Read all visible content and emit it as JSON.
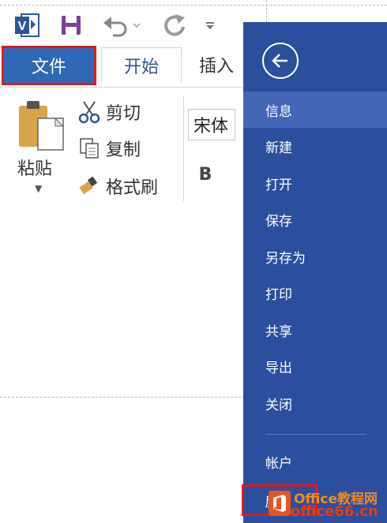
{
  "quick_access": {
    "app_icon": "visio-app-icon",
    "save_icon": "save-icon",
    "undo_icon": "undo-icon",
    "redo_icon": "redo-icon",
    "more_icon": "customize-dropdown-icon"
  },
  "tabs": {
    "file": "文件",
    "home": "开始",
    "insert": "插入"
  },
  "clipboard": {
    "paste": "粘贴",
    "cut": "剪切",
    "copy": "复制",
    "format_painter": "格式刷"
  },
  "font": {
    "name": "宋体",
    "bold": "B"
  },
  "backstage": {
    "menu": [
      {
        "label": "信息",
        "active": true
      },
      {
        "label": "新建"
      },
      {
        "label": "打开"
      },
      {
        "label": "保存"
      },
      {
        "label": "另存为"
      },
      {
        "label": "打印"
      },
      {
        "label": "共享"
      },
      {
        "label": "导出"
      },
      {
        "label": "关闭"
      }
    ],
    "account": "帐户",
    "feedback": "反馈"
  },
  "watermark": {
    "line1": "Office教程网",
    "line2": "office66.cn"
  },
  "colors": {
    "file_tab": "#2f68b4",
    "backstage_bg": "#2b4f9e",
    "highlight_box": "#e01a1a"
  }
}
